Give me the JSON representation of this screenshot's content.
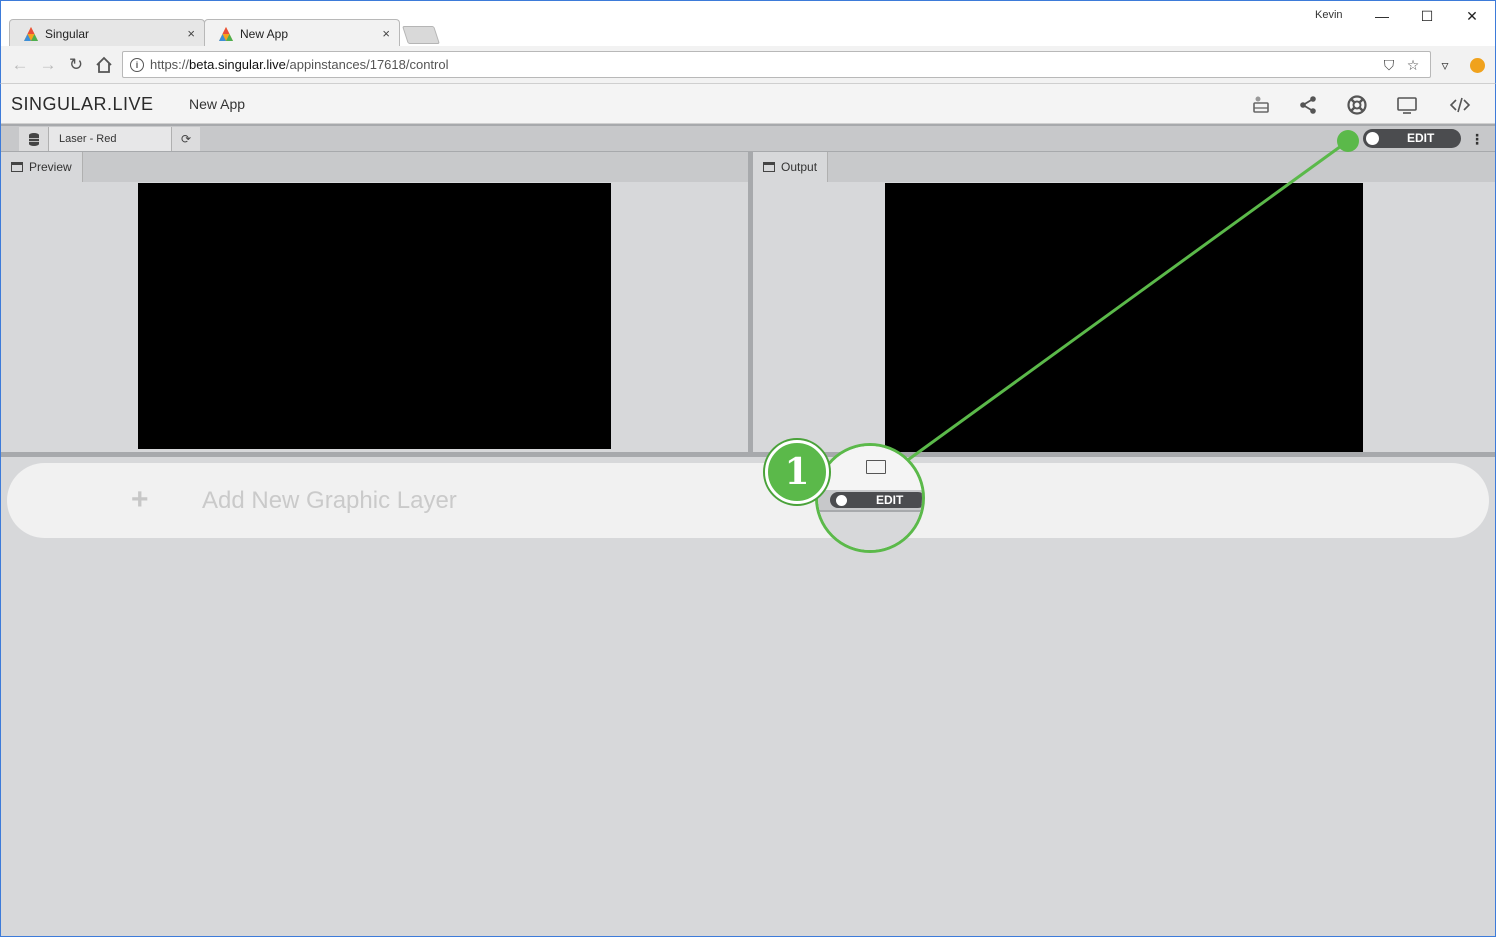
{
  "browser": {
    "tabs": [
      {
        "title": "Singular",
        "close": "×"
      },
      {
        "title": "New App",
        "close": "×"
      }
    ],
    "user": "Kevin",
    "window_buttons": {
      "minimize": "—",
      "maximize": "☐",
      "close": "✕"
    },
    "url_scheme": "https://",
    "url_host": "beta.singular.live",
    "url_path": "/appinstances/17618/control"
  },
  "app": {
    "brand": "SINGULAR.LIVE",
    "name": "New App",
    "toolbar": {
      "composition": "Laser - Red",
      "edit_label": "EDIT"
    },
    "panels": {
      "preview": "Preview",
      "output": "Output"
    },
    "add_layer": {
      "plus": "+",
      "label": "Add New Graphic Layer"
    }
  },
  "callout": {
    "number": "1",
    "edit_label": "EDIT"
  },
  "colors": {
    "accent_green": "#5bb94a",
    "toggle_bg": "#4b4c4f",
    "window_border": "#3d7bd9"
  }
}
